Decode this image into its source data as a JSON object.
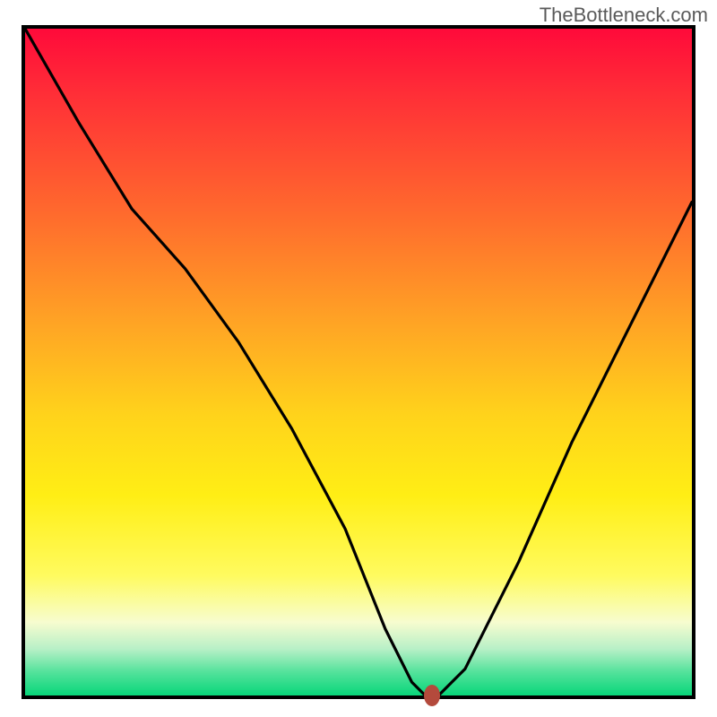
{
  "watermark": "TheBottleneck.com",
  "chart_data": {
    "type": "line",
    "title": "",
    "xlabel": "",
    "ylabel": "",
    "xlim": [
      0,
      100
    ],
    "ylim": [
      0,
      100
    ],
    "series": [
      {
        "name": "curve",
        "x": [
          0,
          8,
          16,
          24,
          32,
          40,
          48,
          54,
          58,
          60,
          62,
          66,
          74,
          82,
          90,
          100
        ],
        "values": [
          100,
          86,
          73,
          64,
          53,
          40,
          25,
          10,
          2,
          0,
          0,
          4,
          20,
          38,
          54,
          74
        ]
      }
    ],
    "marker": {
      "x": 61,
      "y": 0,
      "color": "#b44a3c"
    }
  }
}
